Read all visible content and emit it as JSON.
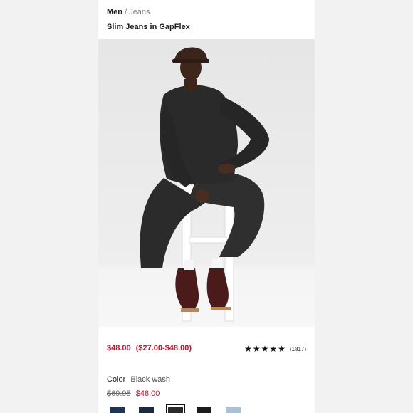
{
  "breadcrumb": {
    "main": "Men",
    "separator": "/",
    "sub": "Jeans"
  },
  "product": {
    "title": "Slim Jeans in GapFlex"
  },
  "pricing": {
    "current": "$48.00",
    "range": "($27.00-$48.00)"
  },
  "rating": {
    "stars": "★★★★★",
    "stars_value": 4.5,
    "count": "(1817)"
  },
  "color": {
    "label": "Color",
    "value": "Black wash",
    "old_price": "$69.95",
    "sale_price": "$48.00"
  },
  "swatches": [
    {
      "name": "swatch-dark-blue",
      "color": "#1f3552"
    },
    {
      "name": "swatch-navy",
      "color": "#1b2a40"
    },
    {
      "name": "swatch-black-wash",
      "color": "#2a2a2a",
      "selected": true
    },
    {
      "name": "swatch-black",
      "color": "#1c1c1c"
    },
    {
      "name": "swatch-light-wash",
      "color": "#a9c1d6"
    }
  ],
  "colors": {
    "sale_red": "#c8102e",
    "backdrop": "#ececec"
  }
}
